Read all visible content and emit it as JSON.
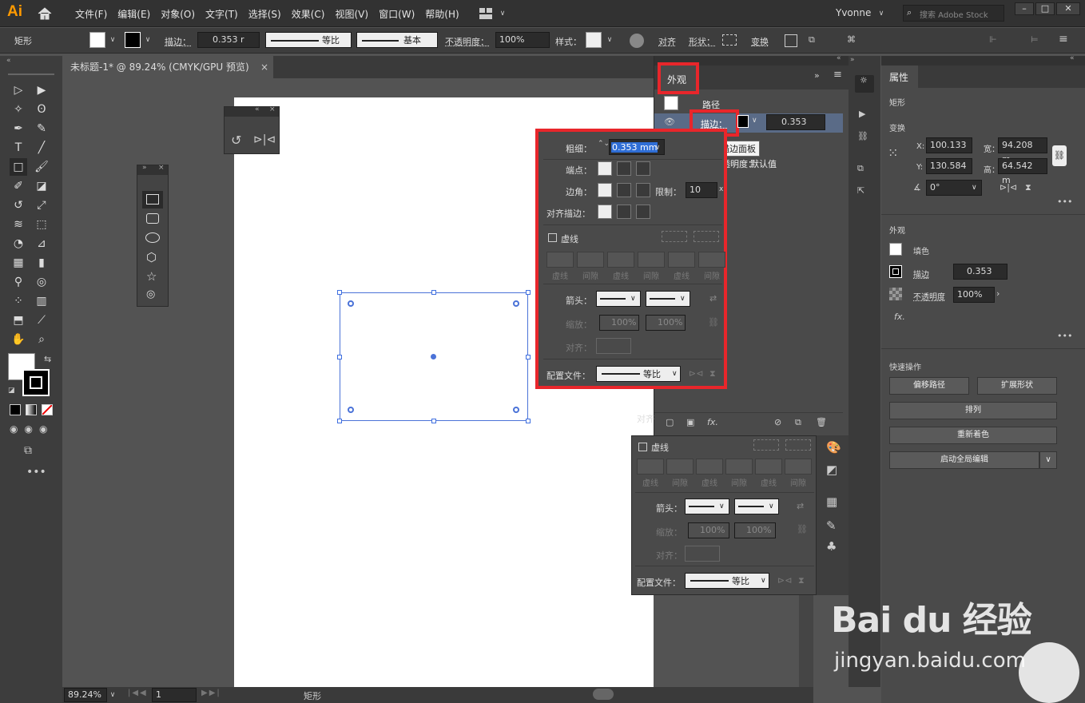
{
  "app": {
    "logo": "Ai",
    "home_icon": "home-icon",
    "user": "Yvonne",
    "search_placeholder": "搜索 Adobe Stock"
  },
  "menu": [
    "文件(F)",
    "编辑(E)",
    "对象(O)",
    "文字(T)",
    "选择(S)",
    "效果(C)",
    "视图(V)",
    "窗口(W)",
    "帮助(H)"
  ],
  "control": {
    "shape_label": "矩形",
    "stroke_label": "描边：",
    "stroke_value": "0.353 r",
    "stroke_profile": "等比",
    "brush_label": "基本",
    "opacity_label": "不透明度：",
    "opacity_value": "100%",
    "style_label": "样式：",
    "align_label": "对齐",
    "shape_prop_label": "形状：",
    "transform_label": "变换"
  },
  "doc": {
    "tab_title": "未标题-1* @ 89.24% (CMYK/GPU 预览)",
    "close_glyph": "×"
  },
  "status": {
    "zoom": "89.24%",
    "page": "1",
    "tool": "矩形"
  },
  "appearance": {
    "tab": "外观",
    "path_label": "路径",
    "stroke_label": "描边：",
    "stroke_value": "0.353",
    "tooltip": "描边面板",
    "opacity_label": "透明度：",
    "opacity_value": "默认值",
    "align_partial": "对齐"
  },
  "stroke_popup": {
    "weight_label": "粗细：",
    "weight_value": "0.353 mm",
    "cap_label": "端点：",
    "corner_label": "边角：",
    "limit_label": "限制：",
    "limit_value": "10",
    "limit_suffix": "x",
    "align_label": "对齐描边：",
    "dash_label": "虚线",
    "dash_cells": [
      "虚线",
      "间隙",
      "虚线",
      "间隙",
      "虚线",
      "间隙"
    ],
    "arrow_label": "箭头：",
    "scale_label": "缩放：",
    "scale_value1": "100%",
    "scale_value2": "100%",
    "align2_label": "对齐：",
    "profile_label": "配置文件：",
    "profile_value": "等比"
  },
  "stroke_panel2": {
    "dash_label": "虚线",
    "dash_cells": [
      "虚线",
      "间隙",
      "虚线",
      "间隙",
      "虚线",
      "间隙"
    ],
    "arrow_label": "箭头：",
    "scale_label": "缩放：",
    "scale_value1": "100%",
    "scale_value2": "100%",
    "align_label": "对齐：",
    "profile_label": "配置文件：",
    "profile_value": "等比"
  },
  "properties": {
    "tab": "属性",
    "section_shape": "矩形",
    "section_transform": "变换",
    "x_label": "X:",
    "x_value": "100.133",
    "w_label": "宽：",
    "w_value": "94.208 m",
    "y_label": "Y:",
    "y_value": "130.584",
    "h_label": "高：",
    "h_value": "64.542 m",
    "angle_value": "0°",
    "section_appearance": "外观",
    "fill_label": "填色",
    "stroke_label": "描边",
    "stroke_value": "0.353",
    "opacity_label": "不透明度",
    "opacity_value": "100%",
    "fx_label": "fx.",
    "section_quick": "快速操作",
    "offset_path": "偏移路径",
    "expand_shape": "扩展形状",
    "arrange": "排列",
    "recolor": "重新着色",
    "global_edit": "启动全局编辑"
  },
  "watermark": {
    "brand": "Bai du 经验",
    "url": "jingyan.baidu.com"
  }
}
